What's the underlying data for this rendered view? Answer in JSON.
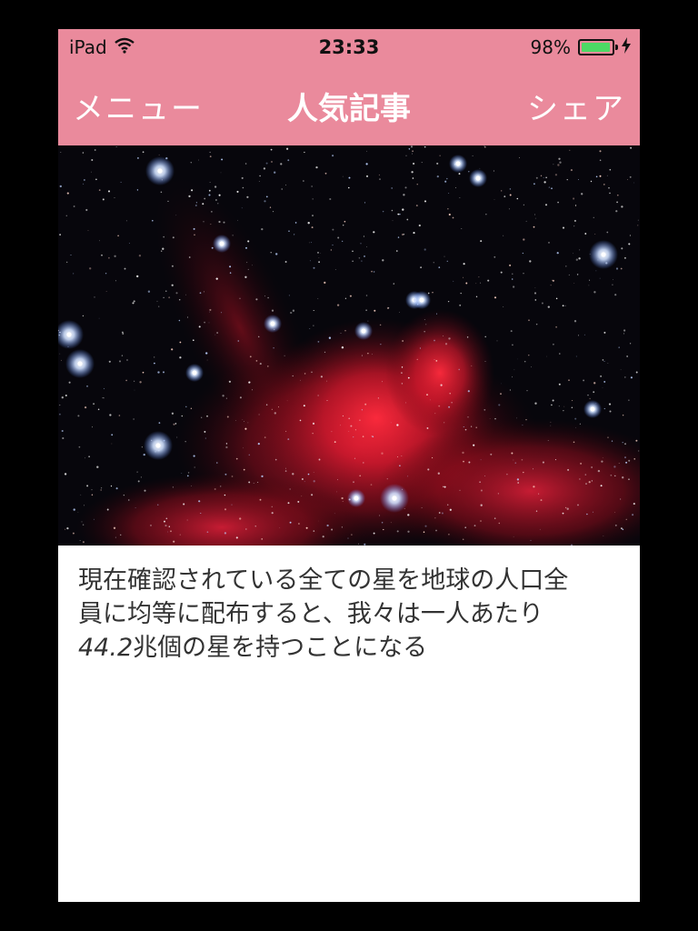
{
  "status": {
    "device": "iPad",
    "time": "23:33",
    "battery": "98%",
    "battery_level": 0.98,
    "icons": [
      "wifi-icon",
      "battery-icon",
      "charging-bolt-icon"
    ]
  },
  "nav": {
    "left_label": "メニュー",
    "title": "人気記事",
    "right_label": "シェア"
  },
  "hero": {
    "icon": "star-field-nebula-image"
  },
  "article": {
    "line1": "現在確認されている全ての星を地球の人口全",
    "line2": "員に均等に配布すると、我々は一人あたり",
    "number": "44.2",
    "line3_rest": "兆個の星を持つことになる"
  },
  "colors": {
    "bar": "#ea8a9c",
    "battery_fill": "#4cd964",
    "text": "#333333"
  }
}
